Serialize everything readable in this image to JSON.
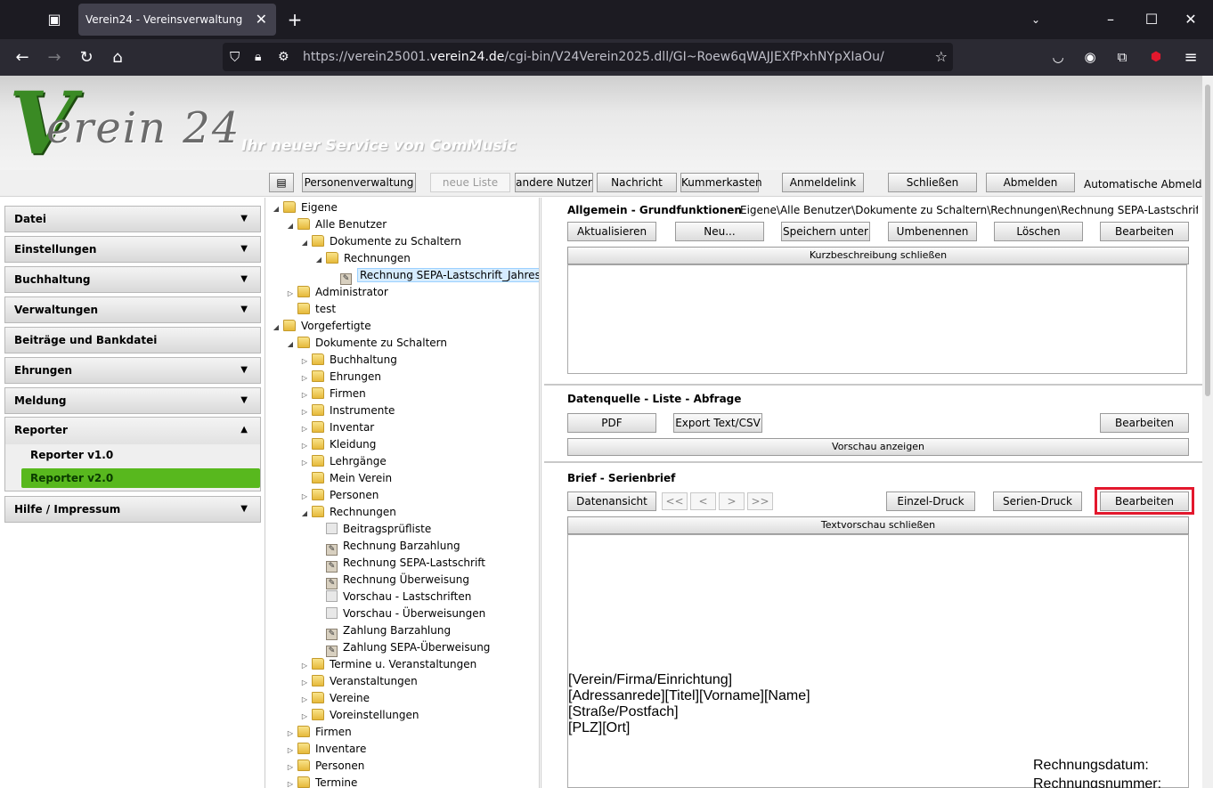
{
  "browser": {
    "tab_title": "Verein24 - Vereinsverwaltung",
    "url_prefix": "https://verein25001.",
    "url_domain": "verein24.de",
    "url_rest": "/cgi-bin/V24Verein2025.dll/GI~Roew6qWAJJEXfPxhNYpXIaOu/"
  },
  "header": {
    "logo_v": "V",
    "logo_text": "erein 24",
    "slogan": "Ihr neuer Service von ComMusic"
  },
  "toolbar": {
    "personenverwaltung": "Personenverwaltung",
    "neue_liste": "neue Liste",
    "andere_nutzer": "andere Nutzer",
    "nachricht": "Nachricht",
    "kummerkasten": "Kummerkasten",
    "anmeldelink": "Anmeldelink",
    "schliessen": "Schließen",
    "abmelden": "Abmelden",
    "auto_logout": "Automatische Abmeldung"
  },
  "menu": {
    "datei": "Datei",
    "einstellungen": "Einstellungen",
    "buchhaltung": "Buchhaltung",
    "verwaltungen": "Verwaltungen",
    "beitraege": "Beiträge und Bankdatei",
    "ehrungen": "Ehrungen",
    "meldung": "Meldung",
    "reporter": "Reporter",
    "reporter_v1": "Reporter v1.0",
    "reporter_v2": "Reporter v2.0",
    "hilfe": "Hilfe / Impressum"
  },
  "tree": [
    {
      "label": "Eigene",
      "type": "folder",
      "indent": 0,
      "exp": "open"
    },
    {
      "label": "Alle Benutzer",
      "type": "folder",
      "indent": 1,
      "exp": "open"
    },
    {
      "label": "Dokumente zu Schaltern",
      "type": "folder",
      "indent": 2,
      "exp": "open"
    },
    {
      "label": "Rechnungen",
      "type": "folder",
      "indent": 3,
      "exp": "open"
    },
    {
      "label": "Rechnung SEPA-Lastschrift_Jahres",
      "type": "report",
      "indent": 4,
      "exp": "",
      "selected": true
    },
    {
      "label": "Administrator",
      "type": "folder",
      "indent": 1,
      "exp": "closed"
    },
    {
      "label": "test",
      "type": "folder",
      "indent": 1,
      "exp": ""
    },
    {
      "label": "Vorgefertigte",
      "type": "folder",
      "indent": 0,
      "exp": "open"
    },
    {
      "label": "Dokumente zu Schaltern",
      "type": "folder",
      "indent": 1,
      "exp": "open"
    },
    {
      "label": "Buchhaltung",
      "type": "folder",
      "indent": 2,
      "exp": "closed"
    },
    {
      "label": "Ehrungen",
      "type": "folder",
      "indent": 2,
      "exp": "closed"
    },
    {
      "label": "Firmen",
      "type": "folder",
      "indent": 2,
      "exp": "closed"
    },
    {
      "label": "Instrumente",
      "type": "folder",
      "indent": 2,
      "exp": "closed"
    },
    {
      "label": "Inventar",
      "type": "folder",
      "indent": 2,
      "exp": "closed"
    },
    {
      "label": "Kleidung",
      "type": "folder",
      "indent": 2,
      "exp": "closed"
    },
    {
      "label": "Lehrgänge",
      "type": "folder",
      "indent": 2,
      "exp": "closed"
    },
    {
      "label": "Mein Verein",
      "type": "folder",
      "indent": 2,
      "exp": ""
    },
    {
      "label": "Personen",
      "type": "folder",
      "indent": 2,
      "exp": "closed"
    },
    {
      "label": "Rechnungen",
      "type": "folder",
      "indent": 2,
      "exp": "open"
    },
    {
      "label": "Beitragsprüfliste",
      "type": "list",
      "indent": 3,
      "exp": ""
    },
    {
      "label": "Rechnung Barzahlung",
      "type": "report",
      "indent": 3,
      "exp": ""
    },
    {
      "label": "Rechnung SEPA-Lastschrift",
      "type": "report",
      "indent": 3,
      "exp": ""
    },
    {
      "label": "Rechnung Überweisung",
      "type": "report",
      "indent": 3,
      "exp": ""
    },
    {
      "label": "Vorschau - Lastschriften",
      "type": "list",
      "indent": 3,
      "exp": ""
    },
    {
      "label": "Vorschau - Überweisungen",
      "type": "list",
      "indent": 3,
      "exp": ""
    },
    {
      "label": "Zahlung Barzahlung",
      "type": "report",
      "indent": 3,
      "exp": ""
    },
    {
      "label": "Zahlung SEPA-Überweisung",
      "type": "report",
      "indent": 3,
      "exp": ""
    },
    {
      "label": "Termine u. Veranstaltungen",
      "type": "folder",
      "indent": 2,
      "exp": "closed"
    },
    {
      "label": "Veranstaltungen",
      "type": "folder",
      "indent": 2,
      "exp": "closed"
    },
    {
      "label": "Vereine",
      "type": "folder",
      "indent": 2,
      "exp": "closed"
    },
    {
      "label": "Voreinstellungen",
      "type": "folder",
      "indent": 2,
      "exp": "closed"
    },
    {
      "label": "Firmen",
      "type": "folder",
      "indent": 1,
      "exp": "closed"
    },
    {
      "label": "Inventare",
      "type": "folder",
      "indent": 1,
      "exp": "closed"
    },
    {
      "label": "Personen",
      "type": "folder",
      "indent": 1,
      "exp": "closed"
    },
    {
      "label": "Termine",
      "type": "folder",
      "indent": 1,
      "exp": "closed"
    }
  ],
  "allgemein": {
    "title": "Allgemein - Grundfunktionen",
    "path": "Eigene\\Alle Benutzer\\Dokumente zu Schaltern\\Rechnungen\\Rechnung SEPA-Lastschrift_Jahres",
    "aktualisieren": "Aktualisieren",
    "neu": "Neu...",
    "speichern_unter": "Speichern unter",
    "umbenennen": "Umbenennen",
    "loeschen": "Löschen",
    "bearbeiten": "Bearbeiten",
    "kurzbeschreibung": "Kurzbeschreibung schließen"
  },
  "datenquelle": {
    "title": "Datenquelle - Liste - Abfrage",
    "pdf": "PDF",
    "export": "Export Text/CSV",
    "bearbeiten": "Bearbeiten",
    "vorschau": "Vorschau anzeigen"
  },
  "brief": {
    "title": "Brief - Serienbrief",
    "datenansicht": "Datenansicht",
    "first": "<<",
    "prev": "<",
    "next": ">",
    "last": ">>",
    "einzel_druck": "Einzel-Druck",
    "serien_druck": "Serien-Druck",
    "bearbeiten": "Bearbeiten",
    "textvorschau": "Textvorschau schließen",
    "line1": "[Verein/Firma/Einrichtung]",
    "line2": "[Adressanrede][Titel][Vorname][Name]",
    "line3": "[Straße/Postfach]",
    "line4": "[PLZ][Ort]",
    "rechnungsdatum": "Rechnungsdatum:",
    "rechnungsnummer": "Rechnungsnummer:"
  }
}
